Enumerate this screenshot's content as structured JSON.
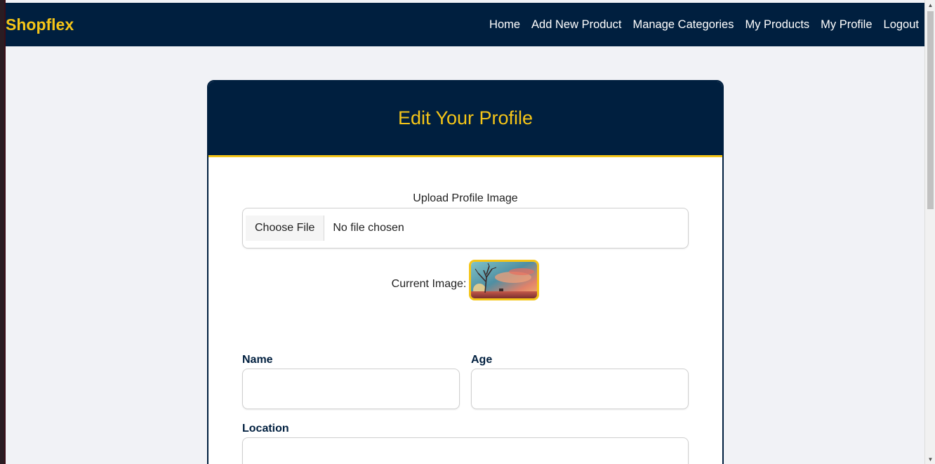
{
  "navbar": {
    "brand": "Shopflex",
    "links": [
      "Home",
      "Add New Product",
      "Manage Categories",
      "My Products",
      "My Profile",
      "Logout"
    ]
  },
  "card": {
    "title": "Edit Your Profile",
    "upload_label": "Upload Profile Image",
    "file_button": "Choose File",
    "file_status": "No file chosen",
    "current_image_label": "Current Image:",
    "fields": {
      "name_label": "Name",
      "name_value": "",
      "age_label": "Age",
      "age_value": "",
      "location_label": "Location",
      "location_value": ""
    }
  },
  "colors": {
    "navy": "#001f3f",
    "accent": "#f5c518",
    "page_bg": "#f1f2f6"
  }
}
